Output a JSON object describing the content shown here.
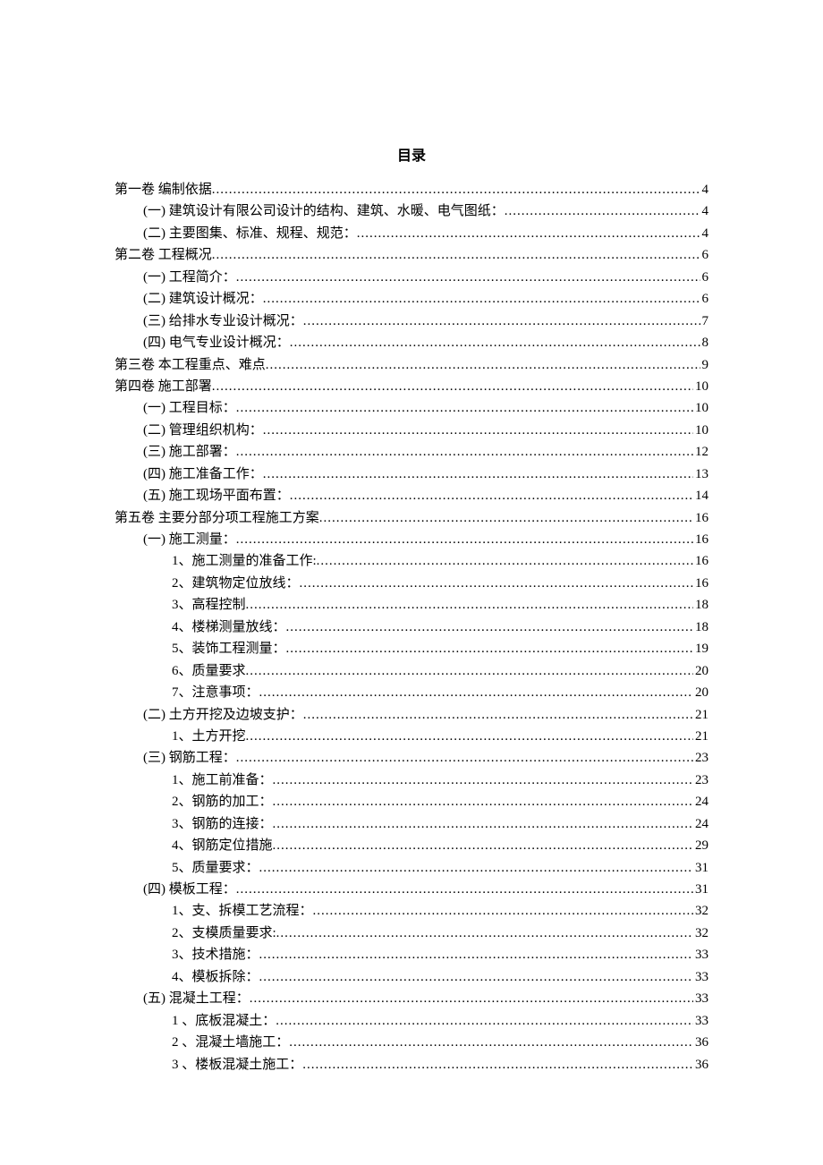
{
  "title": "目录",
  "toc": [
    {
      "level": 1,
      "label": "第一卷 编制依据",
      "page": "4"
    },
    {
      "level": 2,
      "label": "(一) 建筑设计有限公司设计的结构、建筑、水暖、电气图纸：",
      "page": "4"
    },
    {
      "level": 2,
      "label": "(二) 主要图集、标准、规程、规范：",
      "page": "4"
    },
    {
      "level": 1,
      "label": "第二卷 工程概况",
      "page": "6"
    },
    {
      "level": 2,
      "label": "(一) 工程简介：",
      "page": "6"
    },
    {
      "level": 2,
      "label": "(二) 建筑设计概况：",
      "page": "6"
    },
    {
      "level": 2,
      "label": "(三) 给排水专业设计概况：",
      "page": "7"
    },
    {
      "level": 2,
      "label": "(四) 电气专业设计概况：",
      "page": "8"
    },
    {
      "level": 1,
      "label": "第三卷 本工程重点、难点",
      "page": "9"
    },
    {
      "level": 1,
      "label": "第四卷 施工部署",
      "page": "10"
    },
    {
      "level": 2,
      "label": "(一) 工程目标：",
      "page": "10"
    },
    {
      "level": 2,
      "label": "(二) 管理组织机构：",
      "page": "10"
    },
    {
      "level": 2,
      "label": "(三) 施工部署：",
      "page": "12"
    },
    {
      "level": 2,
      "label": "(四) 施工准备工作：",
      "page": "13"
    },
    {
      "level": 2,
      "label": "(五) 施工现场平面布置：",
      "page": "14"
    },
    {
      "level": 1,
      "label": "第五卷 主要分部分项工程施工方案",
      "page": "16"
    },
    {
      "level": 2,
      "label": "(一) 施工测量：",
      "page": "16"
    },
    {
      "level": 3,
      "label": "1、施工测量的准备工作:",
      "page": "16"
    },
    {
      "level": 3,
      "label": "2、建筑物定位放线：",
      "page": "16"
    },
    {
      "level": 3,
      "label": "3、高程控制",
      "page": "18"
    },
    {
      "level": 3,
      "label": "4、楼梯测量放线：",
      "page": "18"
    },
    {
      "level": 3,
      "label": "5、装饰工程测量：",
      "page": "19"
    },
    {
      "level": 3,
      "label": "6、质量要求",
      "page": "20"
    },
    {
      "level": 3,
      "label": "7、注意事项：",
      "page": "20"
    },
    {
      "level": 2,
      "label": "(二) 土方开挖及边坡支护：",
      "page": "21"
    },
    {
      "level": 3,
      "label": "1、土方开挖",
      "page": "21"
    },
    {
      "level": 2,
      "label": "(三) 钢筋工程：",
      "page": "23"
    },
    {
      "level": 3,
      "label": "1、施工前准备：",
      "page": "23"
    },
    {
      "level": 3,
      "label": "2、钢筋的加工：",
      "page": "24"
    },
    {
      "level": 3,
      "label": "3、钢筋的连接：",
      "page": "24"
    },
    {
      "level": 3,
      "label": "4、钢筋定位措施",
      "page": "29"
    },
    {
      "level": 3,
      "label": "5、质量要求：",
      "page": "31"
    },
    {
      "level": 2,
      "label": "(四) 模板工程：",
      "page": "31"
    },
    {
      "level": 3,
      "label": "1、支、拆模工艺流程：",
      "page": "32"
    },
    {
      "level": 3,
      "label": "2、支模质量要求:",
      "page": "32"
    },
    {
      "level": 3,
      "label": "3、技术措施：",
      "page": "33"
    },
    {
      "level": 3,
      "label": "4、模板拆除：",
      "page": "33"
    },
    {
      "level": 2,
      "label": "(五) 混凝土工程：",
      "page": "33"
    },
    {
      "level": 3,
      "label": "1 、底板混凝土：",
      "page": "33"
    },
    {
      "level": 3,
      "label": "2 、混凝土墙施工：",
      "page": "36"
    },
    {
      "level": 3,
      "label": "3 、楼板混凝土施工：",
      "page": "36"
    }
  ]
}
